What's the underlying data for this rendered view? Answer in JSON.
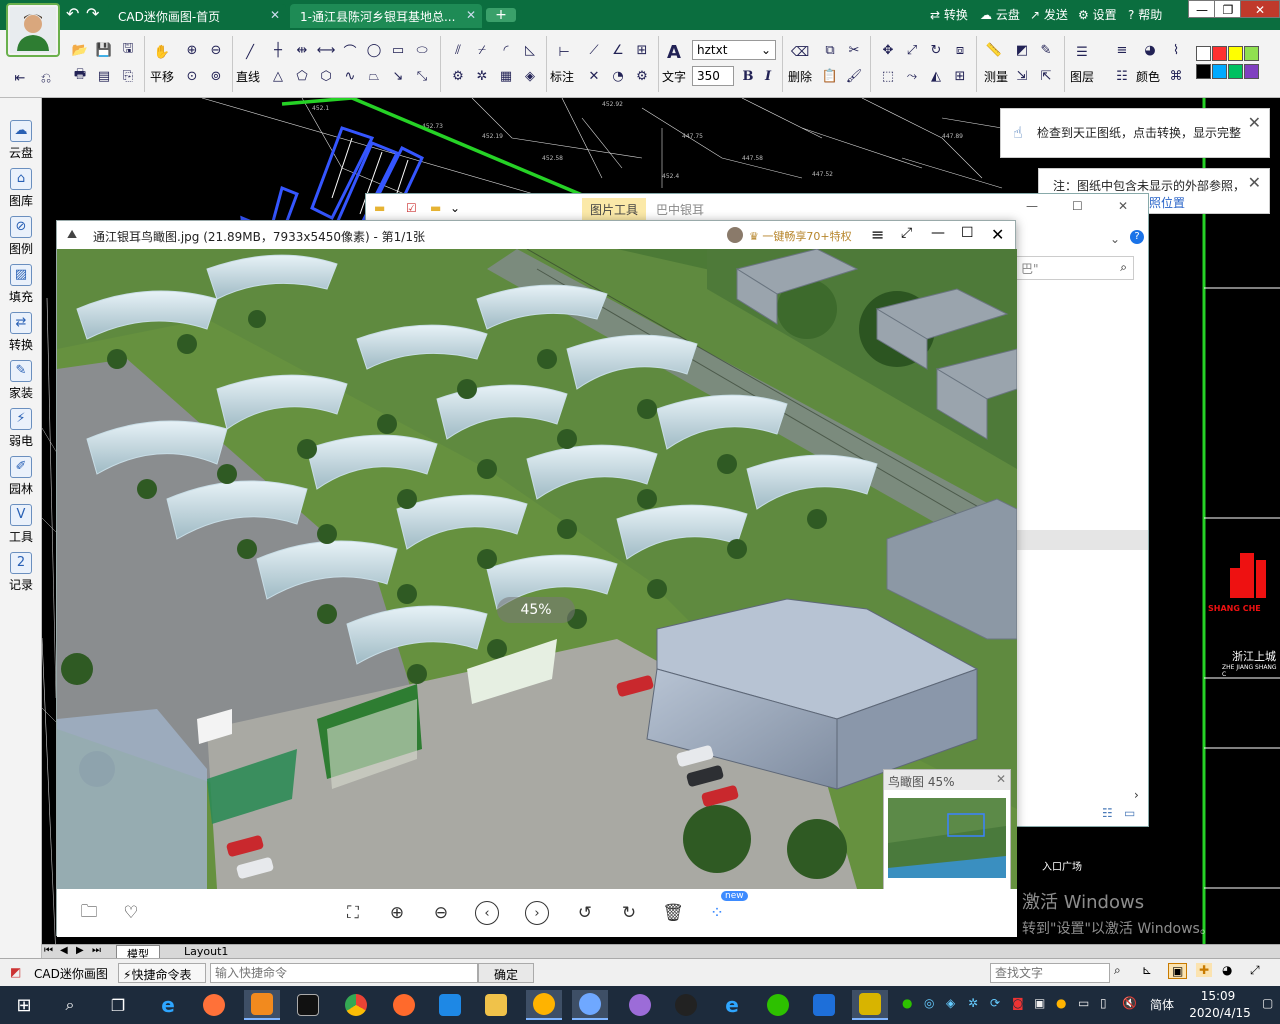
{
  "app": {
    "nav_back": "↶",
    "nav_forward": "↷",
    "tabs": [
      {
        "label": "CAD迷你画图-首页",
        "active": false
      },
      {
        "label": "1-通江县陈河乡银耳基地总...",
        "active": true
      }
    ],
    "tab_add": "+",
    "top_actions": [
      "转换",
      "云盘",
      "发送",
      "设置",
      "帮助"
    ],
    "top_action_icons": [
      "convert-icon",
      "cloud-icon",
      "send-icon",
      "gear-icon",
      "help-icon"
    ]
  },
  "toolbar": {
    "pan_label": "平移",
    "line_label": "直线",
    "dimension_label": "标注",
    "text_label": "文字",
    "font_value": "hztxt",
    "size_value": "350",
    "bold": "B",
    "italic": "I",
    "delete_label": "删除",
    "measure_label": "测量",
    "layer_label": "图层",
    "color_label": "颜色",
    "swatches": [
      "#ffffff",
      "#ff3030",
      "#ffff00",
      "#90e050",
      "#000000",
      "#00aaff",
      "#00c060",
      "#8040c0"
    ]
  },
  "sidebar": {
    "items": [
      {
        "label": "云盘",
        "icon": "cloud-icon"
      },
      {
        "label": "图库",
        "icon": "library-icon"
      },
      {
        "label": "图例",
        "icon": "legend-icon"
      },
      {
        "label": "填充",
        "icon": "hatch-icon"
      },
      {
        "label": "转换",
        "icon": "convert-icon"
      },
      {
        "label": "家装",
        "icon": "home-design-icon"
      },
      {
        "label": "弱电",
        "icon": "low-voltage-icon"
      },
      {
        "label": "园林",
        "icon": "garden-icon"
      },
      {
        "label": "工具",
        "icon": "tools-icon"
      },
      {
        "label": "记录",
        "icon": "record-icon"
      }
    ]
  },
  "notices": {
    "tianzheng": "检查到天正图纸，点击转换，显示完整",
    "xref_line1": "注：图纸中包含未显示的外部参照，",
    "xref_line2": "新参照位置"
  },
  "explorer": {
    "ribbon_tab": "图片工具",
    "title": "巴中银耳",
    "search_hint": "巴\""
  },
  "viewer": {
    "title": "通江银耳鸟瞰图.jpg (21.89MB，7933x5450像素) - 第1/1张",
    "share_label": "一键畅享70+特权",
    "zoom_badge": "45%",
    "minimap_title": "鸟瞰图 45%",
    "bottom_new_badge": "new"
  },
  "cad_right": {
    "logo_text": "SHANG CHE",
    "company": "浙江上城",
    "company_en": "ZHE JIANG SHANG C",
    "entrance": "入口广场"
  },
  "layout_tabs": [
    "模型",
    "Layout1"
  ],
  "cmdbar": {
    "app_name": "CAD迷你画图",
    "quick_table": "快捷命令表",
    "input_placeholder": "输入快捷命令",
    "confirm": "确定",
    "search_placeholder": "查找文字"
  },
  "watermark": {
    "line1": "激活 Windows",
    "line2": "转到\"设置\"以激活 Windows。"
  },
  "taskbar": {
    "time": "15:09",
    "date": "2020/4/15",
    "ime": "简体",
    "apps": [
      "start-icon",
      "search-icon",
      "task-view-icon",
      "ie-icon",
      "firefox-icon",
      "sublime-icon",
      "terminal-icon",
      "chrome-icon",
      "paint-icon",
      "explorer-icon",
      "folder-icon",
      "cloud-sync-icon",
      "photo-viewer-icon",
      "palette-icon",
      "qq-icon",
      "ie-icon",
      "wechat-icon",
      "wps-icon",
      "cad-mini-icon"
    ]
  }
}
